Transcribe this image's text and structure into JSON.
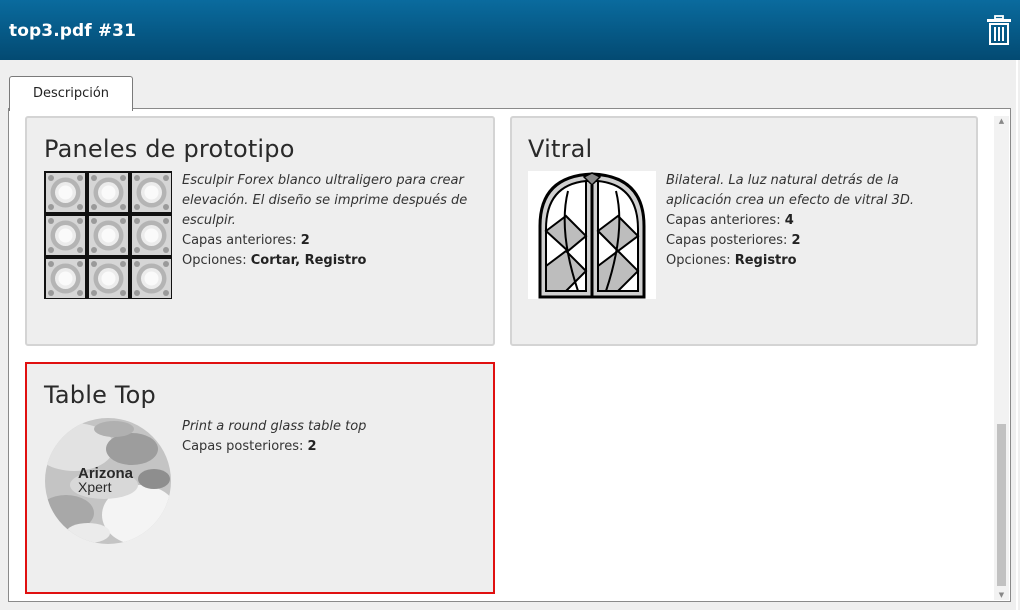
{
  "window": {
    "title": "top3.pdf #31"
  },
  "header": {
    "delete_icon": "trash-icon"
  },
  "tabs": [
    {
      "label": "Descripción",
      "active": true
    }
  ],
  "cards": [
    {
      "title": "Paneles de prototipo",
      "description": "Esculpir Forex blanco ultraligero para crear elevación. El diseño se imprime después de esculpir.",
      "properties": [
        {
          "label": "Capas anteriores:",
          "value": "2"
        },
        {
          "label": "Opciones:",
          "value": "Cortar, Registro"
        }
      ]
    },
    {
      "title": "Vitral",
      "description": "Bilateral. La luz natural detrás de la aplicación crea un efecto de vitral 3D.",
      "properties": [
        {
          "label": "Capas anteriores:",
          "value": "4"
        },
        {
          "label": "Capas posteriores:",
          "value": "2"
        },
        {
          "label": "Opciones:",
          "value": "Registro"
        }
      ]
    },
    {
      "title": "Table Top",
      "description": "Print a round glass table top",
      "properties": [
        {
          "label": "Capas posteriores:",
          "value": "2"
        }
      ],
      "logo": {
        "line1": "Arizona",
        "line2": "Xpert"
      },
      "selected": true
    }
  ],
  "colors": {
    "header_top": "#0a6b9e",
    "header_bottom": "#034a72",
    "selection_border": "#e01010",
    "card_bg": "#eeeeee"
  }
}
